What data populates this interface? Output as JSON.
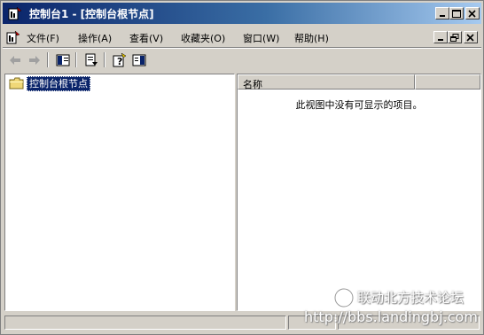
{
  "window": {
    "title": "控制台1 - [控制台根节点]"
  },
  "menu": {
    "items": [
      {
        "label": "文件(F)"
      },
      {
        "label": "操作(A)"
      },
      {
        "label": "查看(V)"
      },
      {
        "label": "收藏夹(O)"
      },
      {
        "label": "窗口(W)"
      },
      {
        "label": "帮助(H)"
      }
    ]
  },
  "tree": {
    "root_label": "控制台根节点"
  },
  "list": {
    "column_name": "名称",
    "empty_message": "此视图中没有可显示的项目。"
  },
  "watermark": {
    "line1": "联动北方技术论坛",
    "line2": "http://bbs.landingbj.com"
  },
  "colors": {
    "title_start": "#0a246a",
    "title_end": "#a6caf0",
    "selection": "#0a246a",
    "face": "#d4d0c8"
  },
  "icons": [
    "mmc-app-icon",
    "minimize-icon",
    "maximize-icon",
    "close-icon",
    "back-arrow-icon",
    "forward-arrow-icon",
    "show-hide-tree-icon",
    "export-list-icon",
    "help-icon",
    "show-hide-action-pane-icon",
    "folder-icon"
  ]
}
